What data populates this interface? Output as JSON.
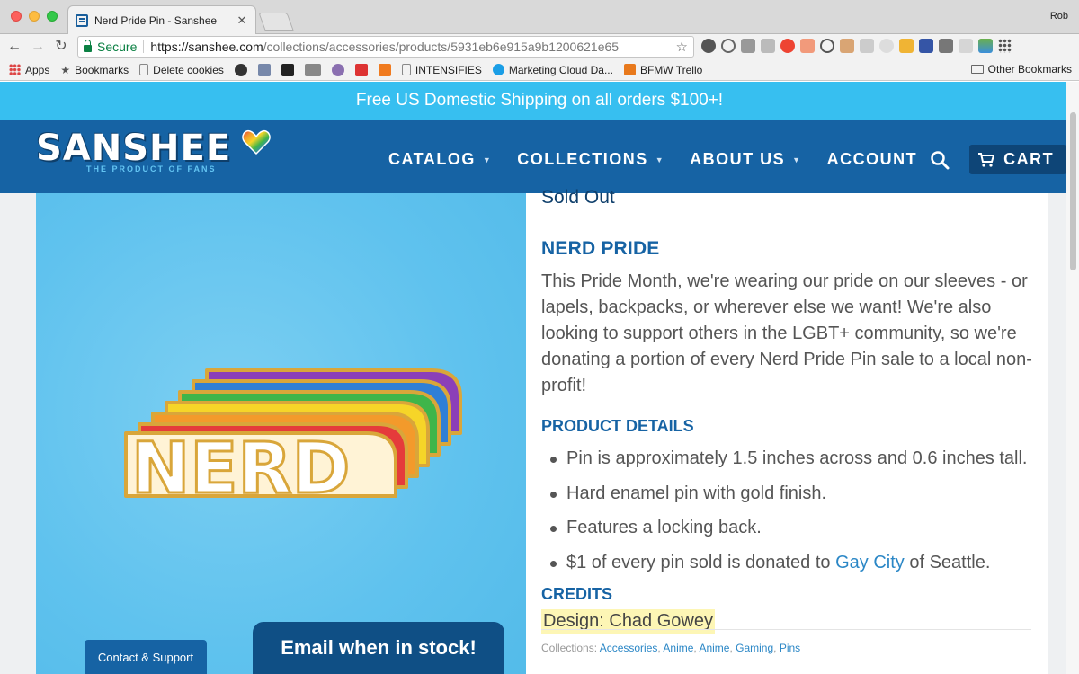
{
  "browser": {
    "tab_title": "Nerd Pride Pin - Sanshee",
    "tab_close": "✕",
    "profile_name": "Rob",
    "secure_label": "Secure",
    "url_host": "https://sanshee.com",
    "url_path": "/collections/accessories/products/5931eb6e915a9b1200621e65",
    "bookmarks": [
      "Apps",
      "Bookmarks",
      "Delete cookies",
      "INTENSIFIES",
      "Marketing Cloud Da...",
      "BFMW Trello"
    ],
    "other_bookmarks": "Other Bookmarks"
  },
  "site": {
    "announcement": "Free US Domestic Shipping on all orders $100+!",
    "logo_text": "SANSHEE",
    "logo_tagline": "THE PRODUCT OF FANS",
    "nav": {
      "catalog": "CATALOG",
      "collections": "COLLECTIONS",
      "about": "ABOUT US",
      "account": "ACCOUNT",
      "cart": "CART"
    },
    "brand_color": "#1663a4",
    "accent_color": "#37bff0"
  },
  "product": {
    "status": "Sold Out",
    "title": "NERD PRIDE",
    "description": "This Pride Month, we're wearing our pride on our sleeves - or lapels, backpacks, or wherever else we want! We're also looking to support others in the LGBT+ community, so we're donating a portion of every Nerd Pride Pin sale to a local non-profit!",
    "details_heading": "PRODUCT DETAILS",
    "details": [
      "Pin is approximately 1.5 inches across and 0.6 inches tall.",
      "Hard enamel pin with gold finish.",
      "Features a locking back."
    ],
    "donation": {
      "prefix": "$1 of every pin sold is donated to ",
      "link": "Gay City",
      "suffix": " of Seattle."
    },
    "credits_heading": "CREDITS",
    "credit": "Design: Chad Gowey",
    "collections_label": "Collections:",
    "collections": [
      "Accessories",
      "Anime",
      "Anime",
      "Gaming",
      "Pins"
    ],
    "pin_text": "NERD"
  },
  "buttons": {
    "contact": "Contact & Support",
    "email_stock": "Email when in stock!"
  }
}
